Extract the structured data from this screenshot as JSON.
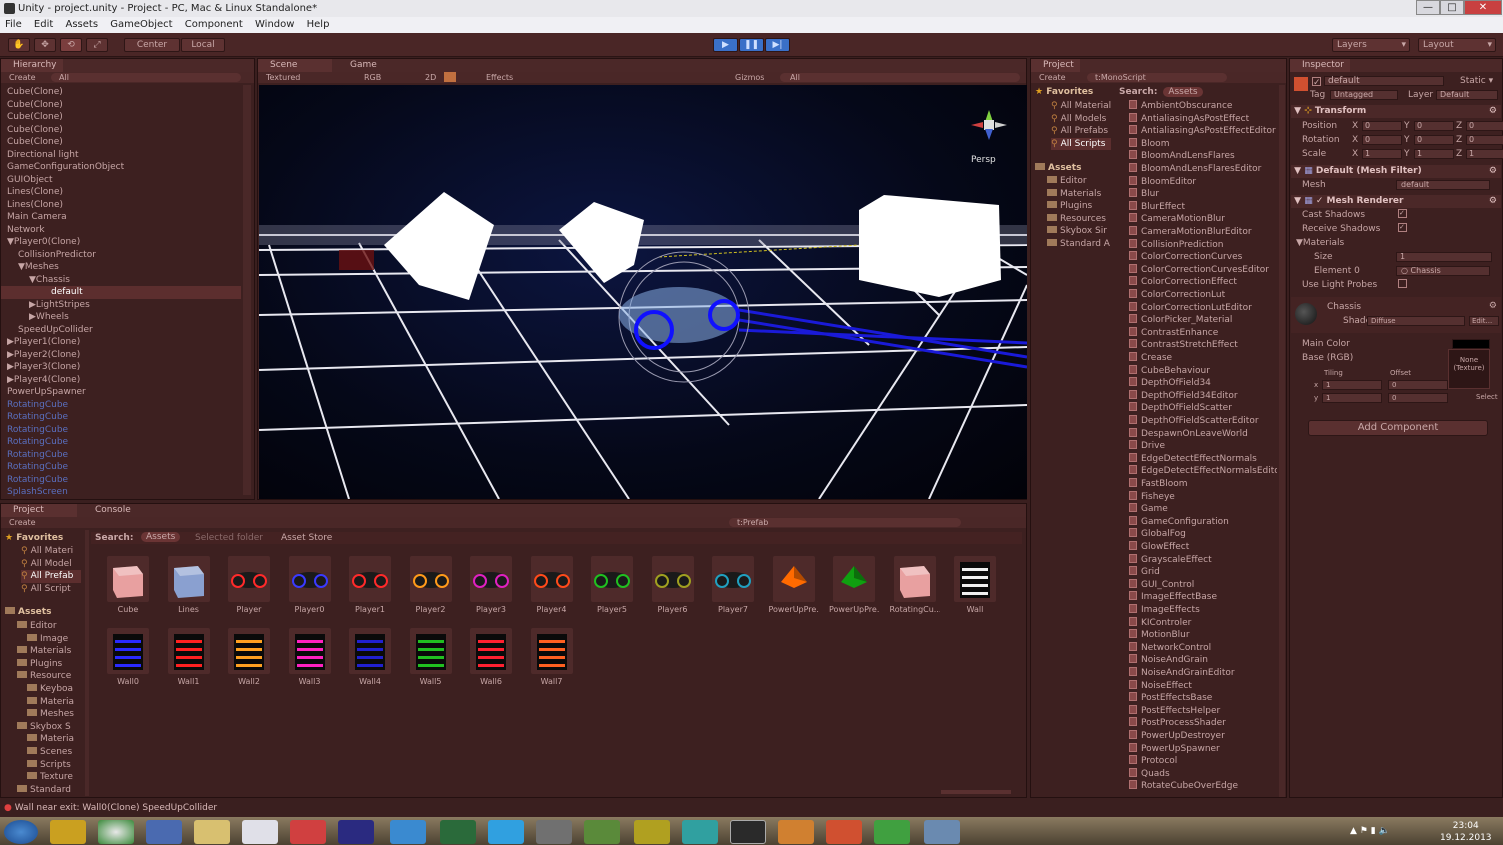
{
  "window": {
    "title": "Unity - project.unity - Project - PC, Mac & Linux Standalone*"
  },
  "menu": [
    "File",
    "Edit",
    "Assets",
    "GameObject",
    "Component",
    "Window",
    "Help"
  ],
  "toolbar": {
    "center": "Center",
    "local": "Local",
    "layers": "Layers",
    "layout": "Layout"
  },
  "hierarchy": {
    "tab": "Hierarchy",
    "create": "Create",
    "search": "All",
    "items": [
      {
        "label": "Cube(Clone)",
        "indent": 0,
        "style": "normal"
      },
      {
        "label": "Cube(Clone)",
        "indent": 0,
        "style": "normal"
      },
      {
        "label": "Cube(Clone)",
        "indent": 0,
        "style": "normal"
      },
      {
        "label": "Cube(Clone)",
        "indent": 0,
        "style": "normal"
      },
      {
        "label": "Cube(Clone)",
        "indent": 0,
        "style": "normal"
      },
      {
        "label": "Directional light",
        "indent": 0,
        "style": "normal"
      },
      {
        "label": "GameConfigurationObject",
        "indent": 0,
        "style": "normal"
      },
      {
        "label": "GUIObject",
        "indent": 0,
        "style": "normal"
      },
      {
        "label": "Lines(Clone)",
        "indent": 0,
        "style": "normal"
      },
      {
        "label": "Lines(Clone)",
        "indent": 0,
        "style": "normal"
      },
      {
        "label": "Main Camera",
        "indent": 0,
        "style": "normal"
      },
      {
        "label": "Network",
        "indent": 0,
        "style": "normal"
      },
      {
        "label": "▼Player0(Clone)",
        "indent": 0,
        "style": "normal"
      },
      {
        "label": "CollisionPredictor",
        "indent": 1,
        "style": "normal"
      },
      {
        "label": "▼Meshes",
        "indent": 1,
        "style": "normal"
      },
      {
        "label": "▼Chassis",
        "indent": 2,
        "style": "normal"
      },
      {
        "label": "default",
        "indent": 4,
        "style": "selected"
      },
      {
        "label": "▶LightStripes",
        "indent": 2,
        "style": "normal"
      },
      {
        "label": "▶Wheels",
        "indent": 2,
        "style": "normal"
      },
      {
        "label": "SpeedUpCollider",
        "indent": 1,
        "style": "normal"
      },
      {
        "label": "▶Player1(Clone)",
        "indent": 0,
        "style": "normal"
      },
      {
        "label": "▶Player2(Clone)",
        "indent": 0,
        "style": "normal"
      },
      {
        "label": "▶Player3(Clone)",
        "indent": 0,
        "style": "normal"
      },
      {
        "label": "▶Player4(Clone)",
        "indent": 0,
        "style": "normal"
      },
      {
        "label": "PowerUpSpawner",
        "indent": 0,
        "style": "normal"
      },
      {
        "label": "RotatingCube",
        "indent": 0,
        "style": "blue"
      },
      {
        "label": "RotatingCube",
        "indent": 0,
        "style": "blue"
      },
      {
        "label": "RotatingCube",
        "indent": 0,
        "style": "blue"
      },
      {
        "label": "RotatingCube",
        "indent": 0,
        "style": "blue"
      },
      {
        "label": "RotatingCube",
        "indent": 0,
        "style": "blue"
      },
      {
        "label": "RotatingCube",
        "indent": 0,
        "style": "blue"
      },
      {
        "label": "RotatingCube",
        "indent": 0,
        "style": "blue"
      },
      {
        "label": "SplashScreen",
        "indent": 0,
        "style": "blue"
      }
    ]
  },
  "scene": {
    "tab_scene": "Scene",
    "tab_game": "Game",
    "shading": "Textured",
    "rgb": "RGB",
    "mode2d": "2D",
    "effects": "Effects",
    "gizmos": "Gizmos",
    "search": "All",
    "persp": "Persp"
  },
  "project_top": {
    "tab": "Project",
    "create": "Create",
    "search": "t:MonoScript",
    "favorites_title": "Favorites",
    "favorites": [
      "All Material",
      "All Models",
      "All Prefabs",
      "All Scripts"
    ],
    "assets_title": "Assets",
    "folders": [
      "Editor",
      "Materials",
      "Plugins",
      "Resources",
      "Skybox Sir",
      "Standard A"
    ],
    "search_label": "Search:",
    "search_scope": "Assets",
    "scripts": [
      "AmbientObscurance",
      "AntialiasingAsPostEffect",
      "AntialiasingAsPostEffectEditor",
      "Bloom",
      "BloomAndLensFlares",
      "BloomAndLensFlaresEditor",
      "BloomEditor",
      "Blur",
      "BlurEffect",
      "CameraMotionBlur",
      "CameraMotionBlurEditor",
      "CollisionPrediction",
      "ColorCorrectionCurves",
      "ColorCorrectionCurvesEditor",
      "ColorCorrectionEffect",
      "ColorCorrectionLut",
      "ColorCorrectionLutEditor",
      "ColorPicker_Material",
      "ContrastEnhance",
      "ContrastStretchEffect",
      "Crease",
      "CubeBehaviour",
      "DepthOfField34",
      "DepthOfField34Editor",
      "DepthOfFieldScatter",
      "DepthOfFieldScatterEditor",
      "DespawnOnLeaveWorld",
      "Drive",
      "EdgeDetectEffectNormals",
      "EdgeDetectEffectNormalsEdito",
      "FastBloom",
      "Fisheye",
      "Game",
      "GameConfiguration",
      "GlobalFog",
      "GlowEffect",
      "GrayscaleEffect",
      "Grid",
      "GUI_Control",
      "ImageEffectBase",
      "ImageEffects",
      "KIControler",
      "MotionBlur",
      "NetworkControl",
      "NoiseAndGrain",
      "NoiseAndGrainEditor",
      "NoiseEffect",
      "PostEffectsBase",
      "PostEffectsHelper",
      "PostProcessShader",
      "PowerUpDestroyer",
      "PowerUpSpawner",
      "Protocol",
      "Quads",
      "RotateCubeOverEdge"
    ]
  },
  "project_bottom": {
    "tab_project": "Project",
    "tab_console": "Console",
    "create": "Create",
    "search": "t:Prefab",
    "favorites_title": "Favorites",
    "favorites": [
      "All Materi",
      "All Model",
      "All Prefab",
      "All Script"
    ],
    "assets_title": "Assets",
    "folders": [
      "Editor",
      "Image",
      "Materials",
      "Plugins",
      "Resource",
      "Keyboa",
      "Materia",
      "Meshes",
      "Skybox S",
      "Materia",
      "Scenes",
      "Scripts",
      "Texture",
      "Standard"
    ],
    "search_label": "Search:",
    "scope_assets": "Assets",
    "scope_selected": "Selected folder",
    "scope_store": "Asset Store",
    "row1": [
      {
        "name": "Cube",
        "kind": "cube",
        "color": "#e8a0a0"
      },
      {
        "name": "Lines",
        "kind": "cube",
        "color": "#8aa0d0"
      },
      {
        "name": "Player",
        "kind": "car",
        "color": "#ff2a2a"
      },
      {
        "name": "Player0",
        "kind": "car",
        "color": "#3a3aff"
      },
      {
        "name": "Player1",
        "kind": "car",
        "color": "#ff2a2a"
      },
      {
        "name": "Player2",
        "kind": "car",
        "color": "#ff9a1a"
      },
      {
        "name": "Player3",
        "kind": "car",
        "color": "#e020c0"
      },
      {
        "name": "Player4",
        "kind": "car",
        "color": "#ff4a1a"
      },
      {
        "name": "Player5",
        "kind": "car",
        "color": "#20c020"
      },
      {
        "name": "Player6",
        "kind": "car",
        "color": "#a0a020"
      },
      {
        "name": "Player7",
        "kind": "car",
        "color": "#20a0c0"
      },
      {
        "name": "PowerUpPre...",
        "kind": "gem",
        "color": "#ff6a00"
      },
      {
        "name": "PowerUpPre...",
        "kind": "gem",
        "color": "#10a010"
      },
      {
        "name": "RotatingCu...",
        "kind": "cube",
        "color": "#e8a0a0"
      },
      {
        "name": "Wall",
        "kind": "wall",
        "color": "#f0f0f0"
      }
    ],
    "row2": [
      {
        "name": "Wall0",
        "kind": "wall",
        "color": "#2a2aff"
      },
      {
        "name": "Wall1",
        "kind": "wall",
        "color": "#ff2020"
      },
      {
        "name": "Wall2",
        "kind": "wall",
        "color": "#ffa020"
      },
      {
        "name": "Wall3",
        "kind": "wall",
        "color": "#ff20c0"
      },
      {
        "name": "Wall4",
        "kind": "wall",
        "color": "#2020d0"
      },
      {
        "name": "Wall5",
        "kind": "wall",
        "color": "#20c020"
      },
      {
        "name": "Wall6",
        "kind": "wall",
        "color": "#ff2030"
      },
      {
        "name": "Wall7",
        "kind": "wall",
        "color": "#ff6020"
      }
    ]
  },
  "inspector": {
    "tab": "Inspector",
    "name": "default",
    "static": "Static",
    "tag_label": "Tag",
    "tag": "Untagged",
    "layer_label": "Layer",
    "layer": "Default",
    "transform": {
      "title": "Transform",
      "position": "Position",
      "rotation": "Rotation",
      "scale": "Scale",
      "x": "X",
      "y": "Y",
      "z": "Z",
      "pos": [
        "0",
        "0",
        "0"
      ],
      "rot": [
        "0",
        "0",
        "0"
      ],
      "scl": [
        "1",
        "1",
        "1"
      ]
    },
    "mesh_filter": {
      "title": "Default (Mesh Filter)",
      "mesh_label": "Mesh",
      "mesh": "default"
    },
    "mesh_renderer": {
      "title": "Mesh Renderer",
      "cast": "Cast Shadows",
      "receive": "Receive Shadows",
      "materials": "Materials",
      "size_label": "Size",
      "size": "1",
      "element": "Element 0",
      "element_val": "Chassis",
      "light_probes": "Use Light Probes"
    },
    "material": {
      "name": "Chassis",
      "shader_label": "Shader",
      "shader": "Diffuse",
      "edit": "Edit...",
      "main_color": "Main Color",
      "base": "Base (RGB)",
      "tiling": "Tiling",
      "offset": "Offset",
      "x": "x",
      "y": "y",
      "tx": "1",
      "ty": "1",
      "ox": "0",
      "oy": "0",
      "none": "None",
      "texture": "(Texture)",
      "select": "Select"
    },
    "add_component": "Add Component"
  },
  "status": {
    "text": "Wall near exit: Wall0(Clone) SpeedUpCollider"
  },
  "clock": {
    "time": "23:04",
    "date": "19.12.2013"
  }
}
